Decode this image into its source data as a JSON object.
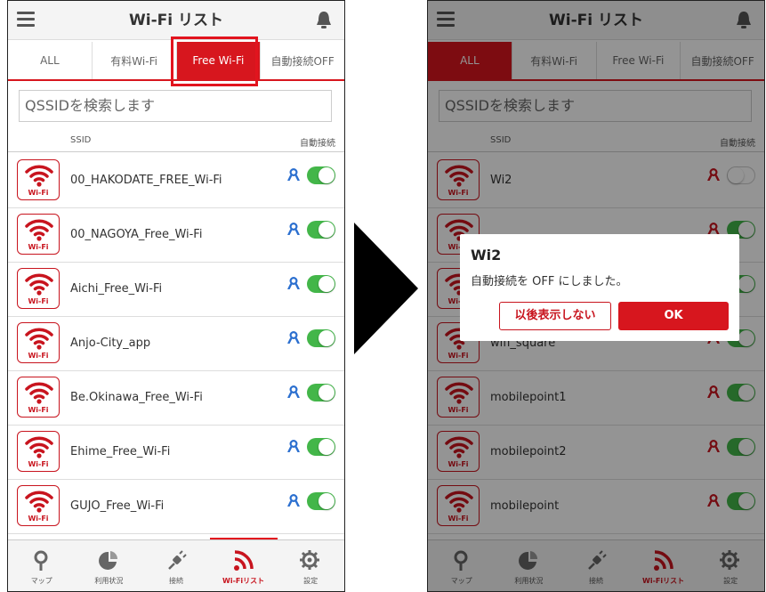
{
  "left": {
    "header": {
      "title": "Wi-Fi リスト"
    },
    "tabs": [
      {
        "label": "ALL"
      },
      {
        "label": "有料Wi-Fi"
      },
      {
        "label": "Free Wi-Fi"
      },
      {
        "label": "自動接続OFF"
      }
    ],
    "active_tab": "Free Wi-Fi",
    "search": {
      "placeholder": "QSSIDを検索します"
    },
    "list_header": {
      "ssid": "SSID",
      "auto": "自動接続"
    },
    "items": [
      {
        "ssid": "00_HAKODATE_FREE_Wi-Fi",
        "auto": true
      },
      {
        "ssid": "00_NAGOYA_Free_Wi-Fi",
        "auto": true
      },
      {
        "ssid": "Aichi_Free_Wi-Fi",
        "auto": true
      },
      {
        "ssid": "Anjo-City_app",
        "auto": true
      },
      {
        "ssid": "Be.Okinawa_Free_Wi-Fi",
        "auto": true
      },
      {
        "ssid": "Ehime_Free_Wi-Fi",
        "auto": true
      },
      {
        "ssid": "GUJO_Free_Wi-Fi",
        "auto": true
      }
    ],
    "logo_label": "Wi-Fi",
    "nav": [
      {
        "label": "マップ",
        "icon": "map-pin-icon"
      },
      {
        "label": "利用状況",
        "icon": "pie-chart-icon"
      },
      {
        "label": "接続",
        "icon": "plug-icon"
      },
      {
        "label": "Wi-Fiリスト",
        "icon": "wifi-list-icon",
        "active": true
      },
      {
        "label": "設定",
        "icon": "gear-icon"
      }
    ]
  },
  "right": {
    "header": {
      "title": "Wi-Fi リスト"
    },
    "tabs": [
      {
        "label": "ALL"
      },
      {
        "label": "有料Wi-Fi"
      },
      {
        "label": "Free Wi-Fi"
      },
      {
        "label": "自動接続OFF"
      }
    ],
    "active_tab": "ALL",
    "search": {
      "placeholder": "QSSIDを検索します"
    },
    "list_header": {
      "ssid": "SSID",
      "auto": "自動接続"
    },
    "items": [
      {
        "ssid": "Wi2",
        "auto": false
      },
      {
        "ssid": "",
        "auto": true
      },
      {
        "ssid": "",
        "auto": true
      },
      {
        "ssid": "wifi_square",
        "auto": true
      },
      {
        "ssid": "mobilepoint1",
        "auto": true
      },
      {
        "ssid": "mobilepoint2",
        "auto": true
      },
      {
        "ssid": "mobilepoint",
        "auto": true
      }
    ],
    "logo_label": "Wi-Fi",
    "dialog": {
      "title": "Wi2",
      "message": "自動接続を OFF にしました。",
      "dismiss_label": "以後表示しない",
      "ok_label": "OK"
    },
    "nav": [
      {
        "label": "マップ",
        "icon": "map-pin-icon"
      },
      {
        "label": "利用状況",
        "icon": "pie-chart-icon"
      },
      {
        "label": "接続",
        "icon": "plug-icon"
      },
      {
        "label": "Wi-Fiリスト",
        "icon": "wifi-list-icon",
        "active": true
      },
      {
        "label": "設定",
        "icon": "gear-icon"
      }
    ]
  },
  "colors": {
    "accent": "#d7161e",
    "toggle_on": "#43b649",
    "highlight": "#e2141e"
  }
}
